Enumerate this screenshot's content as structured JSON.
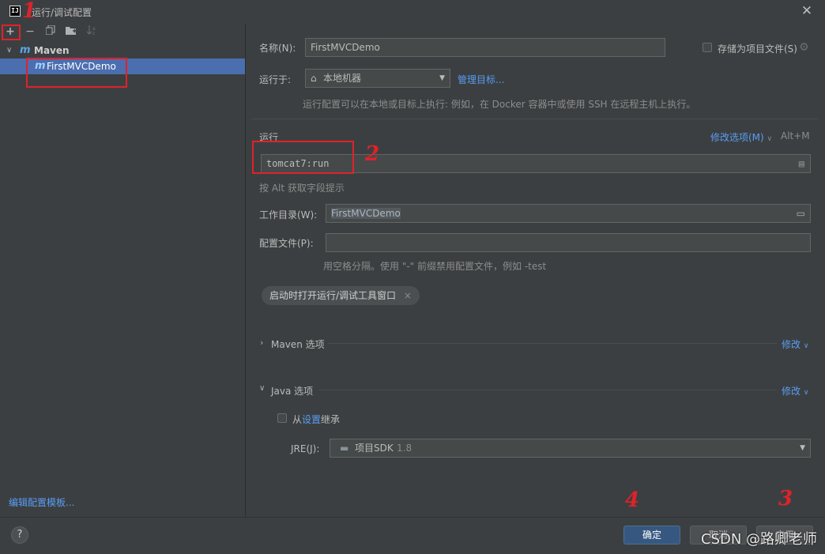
{
  "window": {
    "title": "运行/调试配置",
    "logo_text": "IJ"
  },
  "toolbar": {
    "add": "+",
    "remove": "−"
  },
  "tree": {
    "group": "Maven",
    "item": "FirstMVCDemo",
    "edit_templates": "编辑配置模板..."
  },
  "annotations": {
    "one": "1",
    "two": "2",
    "three": "3",
    "four": "4"
  },
  "form": {
    "name_label": "名称(N):",
    "name_value": "FirstMVCDemo",
    "store_label": "存储为项目文件(S)",
    "run_on_label": "运行于:",
    "run_on_value": "本地机器",
    "manage_targets": "管理目标...",
    "run_on_hint": "运行配置可以在本地或目标上执行: 例如，在 Docker 容器中或使用 SSH 在远程主机上执行。",
    "run_section": "运行",
    "modify_options": "修改选项(M)",
    "modify_shortcut": "Alt+M",
    "command_value": "tomcat7:run",
    "command_hint": "按 Alt 获取字段提示",
    "workdir_label": "工作目录(W):",
    "workdir_value": "FirstMVCDemo",
    "profiles_label": "配置文件(P):",
    "profiles_value": "",
    "profiles_hint": "用空格分隔。使用 \"-\" 前缀禁用配置文件，例如 -test",
    "tag_chip": "启动时打开运行/调试工具窗口",
    "maven_section": "Maven 选项",
    "java_section": "Java 选项",
    "modify": "修改",
    "inherit_prefix": "从",
    "inherit_link": "设置",
    "inherit_suffix": "继承",
    "jre_label": "JRE(J):",
    "jre_value": "项目SDK",
    "jre_version": "1.8"
  },
  "buttons": {
    "ok": "确定",
    "cancel": "取消",
    "apply": "应用",
    "help": "?"
  },
  "watermark": "CSDN @路卿老师"
}
